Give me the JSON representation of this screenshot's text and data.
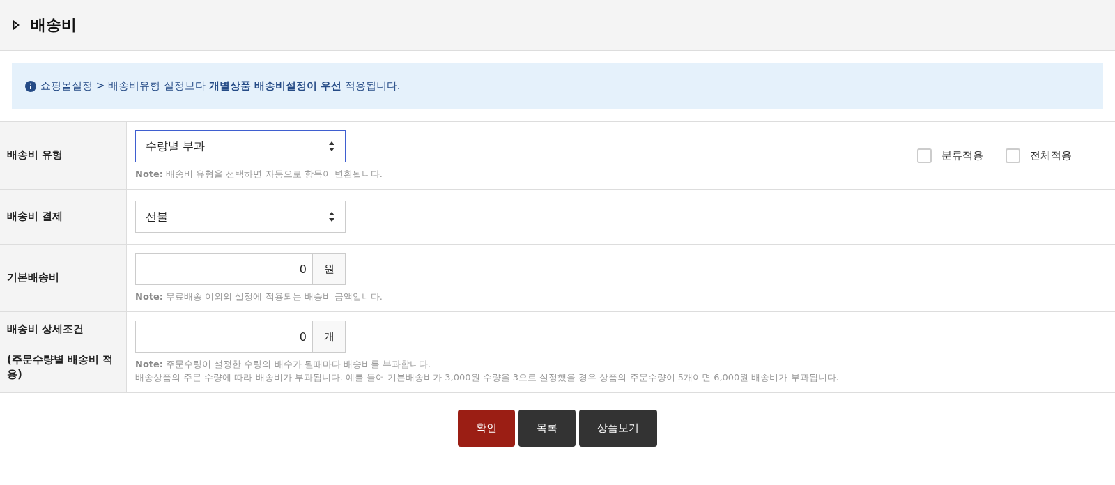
{
  "header": {
    "title": "배송비"
  },
  "notice": {
    "text": "쇼핑몰설정 > 배송비유형 설정보다 **개별상품 배송비설정이 우선** 적용됩니다."
  },
  "rows": [
    {
      "kind": "select",
      "label": "배송비 유형",
      "value": "수량별 부과",
      "focused": true,
      "notes": [
        "**Note:** 배송비 유형을 선택하면 자동으로 항목이 변환됩니다."
      ],
      "options": [
        {
          "label": "분류적용",
          "checked": false
        },
        {
          "label": "전체적용",
          "checked": false
        }
      ]
    },
    {
      "kind": "select",
      "label": "배송비 결제",
      "value": "선불",
      "focused": false,
      "notes": []
    },
    {
      "kind": "number",
      "label": "기본배송비",
      "value": "0",
      "unit": "원",
      "notes": [
        "**Note:** 무료배송 이외의 설정에 적용되는 배송비 금액입니다."
      ]
    },
    {
      "kind": "number",
      "label": "배송비 상세조건\n\n(주문수량별 배송비 적용)",
      "value": "0",
      "unit": "개",
      "notes": [
        "**Note:** 주문수량이 설정한 수량의 배수가 될때마다 배송비를 부과합니다.",
        "배송상품의 주문 수량에 따라 배송비가 부과됩니다. 예를 들어 기본배송비가 3,000원 수량을 3으로 설정했을 경우 상품의 주문수량이 5개이면 6,000원 배송비가 부과됩니다."
      ]
    }
  ],
  "buttons": [
    {
      "label": "확인",
      "kind": "primary"
    },
    {
      "label": "목록",
      "kind": "dark"
    },
    {
      "label": "상품보기",
      "kind": "dark"
    }
  ]
}
